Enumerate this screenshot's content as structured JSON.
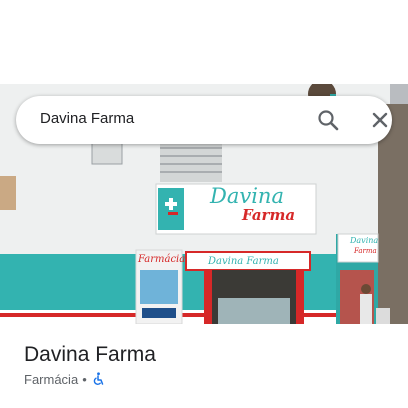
{
  "search": {
    "query": "Davina Farma"
  },
  "photo": {
    "store_sign_line1": "Davina",
    "store_sign_line2": "Farma",
    "awning_text": "Davina Farma",
    "banner_text": "Farmácia",
    "side_sign_line1": "Davina",
    "side_sign_line2": "Farma"
  },
  "place": {
    "name": "Davina Farma",
    "category": "Farmácia",
    "separator": "•",
    "accessibility_icon": "wheelchair-accessible-icon"
  },
  "colors": {
    "teal": "#33b3b0",
    "red": "#d62828",
    "accessibility_blue": "#1a73e8"
  }
}
